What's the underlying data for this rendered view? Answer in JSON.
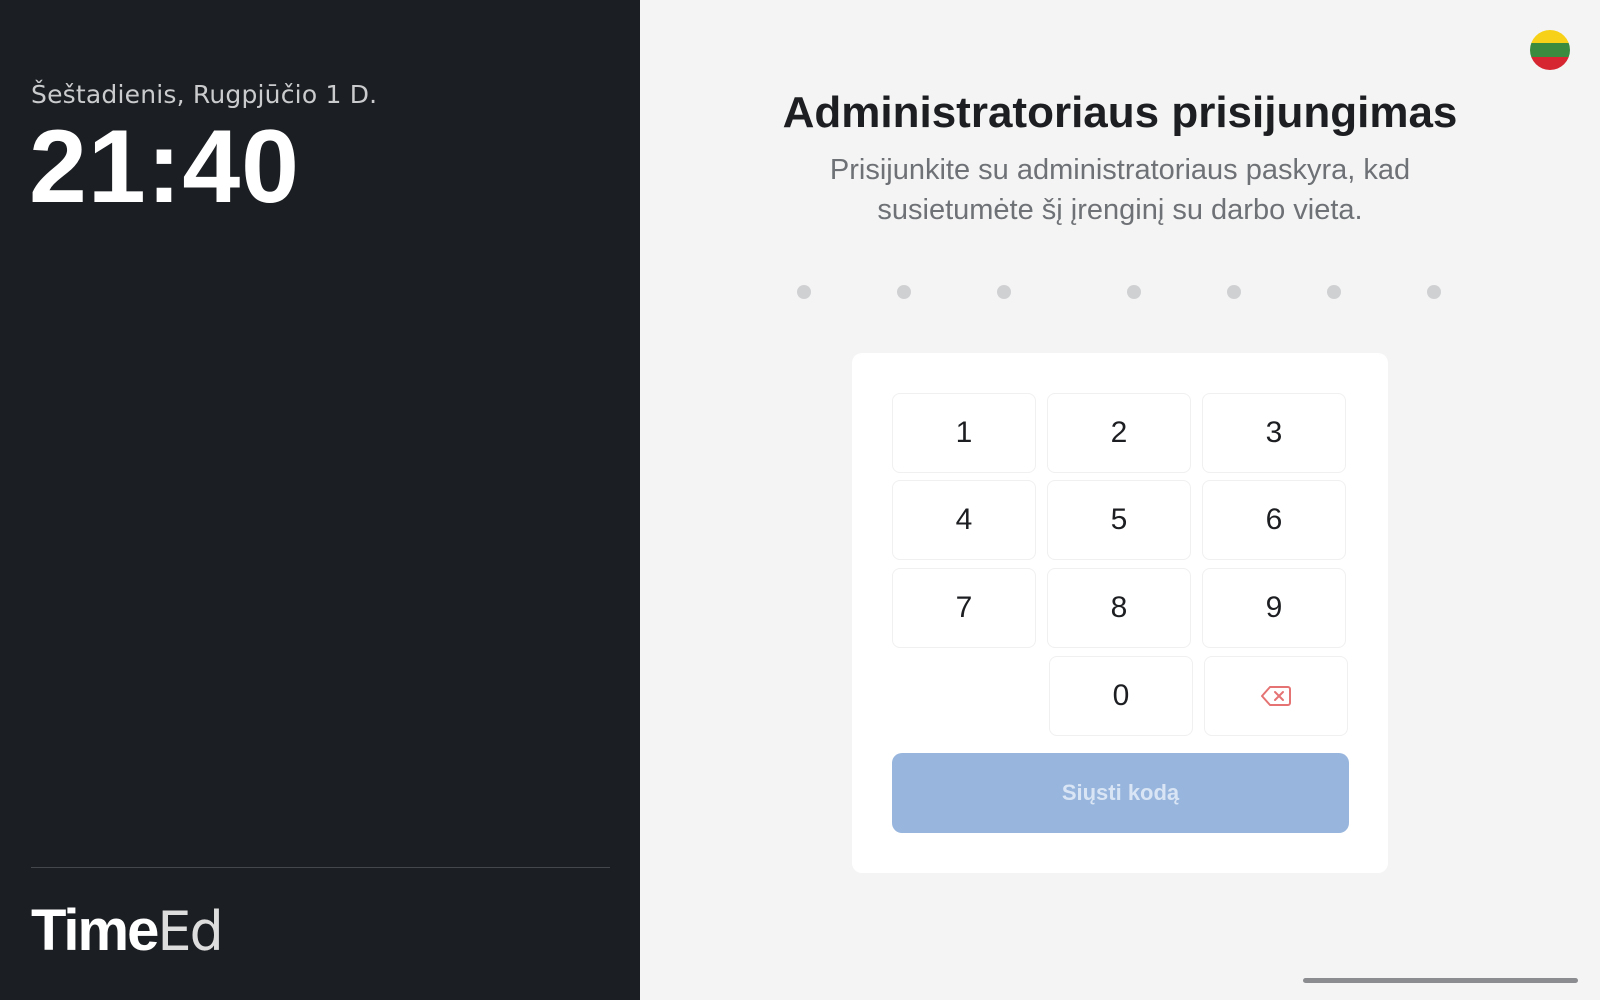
{
  "left_panel": {
    "date": "Šeštadienis, Rugpjūčio 1 D.",
    "time": "21:40",
    "logo": {
      "bold": "Time",
      "thin": "Ed"
    }
  },
  "header": {
    "title": "Administratoriaus prisijungimas",
    "subtitle": "Prisijunkite su administratoriaus paskyra, kad susietumėte šį įrenginį su darbo vieta."
  },
  "language_flag": {
    "icon": "lithuania-flag-icon",
    "colors": [
      "#f7d117",
      "#3a8a3f",
      "#d62631"
    ]
  },
  "code_entry": {
    "length": 7,
    "filled": 0,
    "dot_color": "#cfd0d2"
  },
  "keypad": {
    "keys": [
      "1",
      "2",
      "3",
      "4",
      "5",
      "6",
      "7",
      "8",
      "9",
      "0"
    ],
    "backspace_icon": "backspace-icon",
    "backspace_color": "#e57373"
  },
  "submit_button": {
    "label": "Siųsti kodą",
    "color": "#97b5dd",
    "state": "disabled"
  }
}
